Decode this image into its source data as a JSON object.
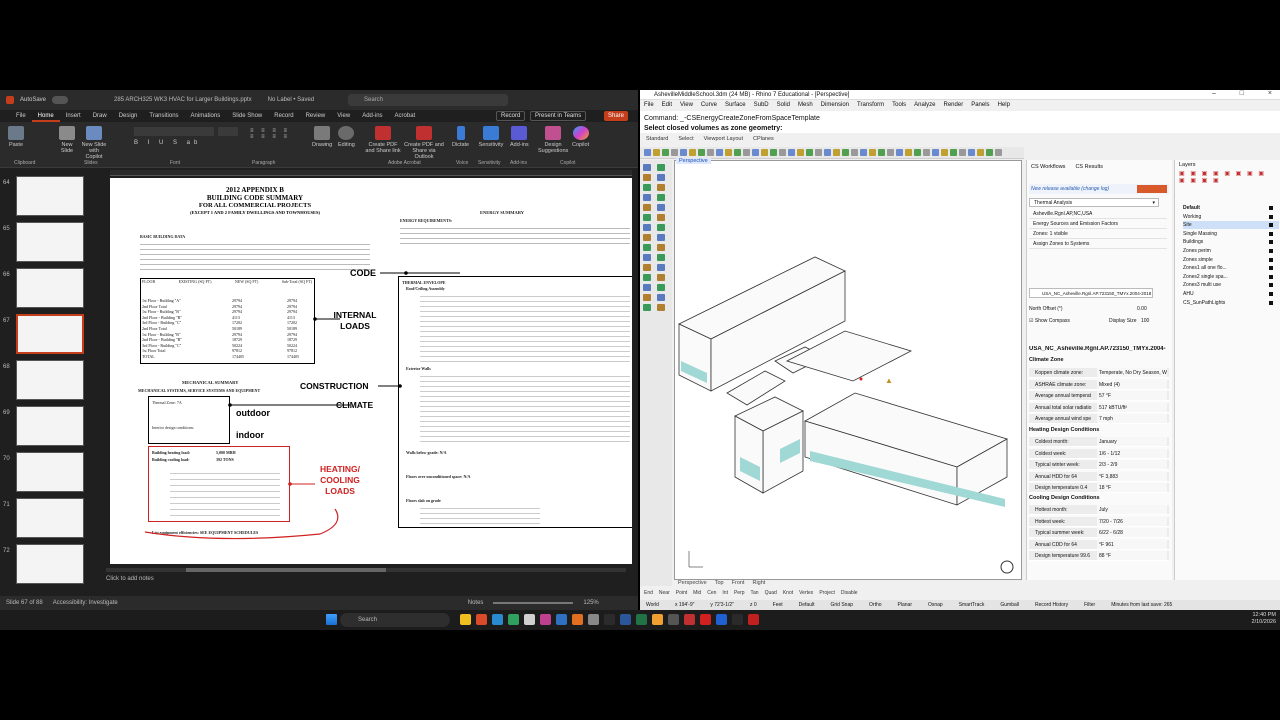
{
  "ppt": {
    "autosave": "AutoSave",
    "file_title": "285 ARCH325 WK3 HVAC for Larger Buildings.pptx",
    "label": "No Label • Saved",
    "search_placeholder": "Search",
    "menu": [
      "File",
      "Home",
      "Insert",
      "Draw",
      "Design",
      "Transitions",
      "Animations",
      "Slide Show",
      "Record",
      "Review",
      "View",
      "Add-ins",
      "Acrobat"
    ],
    "record_btn": "Record",
    "present_btn": "Present in Teams",
    "share_btn": "Share",
    "ribbon": {
      "paste": "Paste",
      "new_slide": "New Slide",
      "new_slide_copilot": "New Slide with Copilot",
      "drawing": "Drawing",
      "editing": "Editing",
      "create_pdf_link": "Create PDF and Share link",
      "create_pdf_outlook": "Create PDF and Share via Outlook",
      "dictate": "Dictate",
      "sensitivity": "Sensitivity",
      "addins": "Add-ins",
      "design_suggestions": "Design Suggestions",
      "copilot": "Copilot",
      "groups": [
        "Clipboard",
        "Slides",
        "Font",
        "Paragraph",
        "Adobe Acrobat",
        "Voice",
        "Sensitivity",
        "Add-ins",
        "Copilot"
      ]
    },
    "thumb_numbers": [
      "64",
      "65",
      "66",
      "67",
      "68",
      "69",
      "70",
      "71",
      "72"
    ],
    "notes": "Click to add notes",
    "status_slide": "Slide 67 of 88",
    "status_access": "Accessibility: Investigate",
    "status_notes": "Notes",
    "zoom": "125%"
  },
  "slide": {
    "title1": "2012 APPENDIX B",
    "title2": "BUILDING CODE SUMMARY",
    "title3": "FOR ALL COMMERCIAL PROJECTS",
    "title4": "(EXCEPT 1 AND 2 FAMILY DWELLINGS AND TOWNHOUSES)",
    "basic": "BASIC BUILDING DATA",
    "mech_summary": "MECHANICAL SUMMARY",
    "mech_sub": "MECHANICAL SYSTEMS, SERVICE SYSTEMS AND EQUIPMENT",
    "energy_summary": "ENERGY SUMMARY",
    "energy_req": "ENERGY REQUIREMENTS:",
    "thermal_env": "THERMAL ENVELOPE",
    "roof": "Roof/Ceiling Assembly",
    "ext_walls": "Exterior Walls",
    "walls_below": "Walls below grade: N/A",
    "floors_over": "Floors over unconditioned space: N/A",
    "floors_slab": "Floors slab on grade",
    "heating_load": "Building heating load:",
    "heating_val": "5,000 MBH",
    "cooling_load": "Building cooling load:",
    "cooling_val": "392 TONS",
    "thermal_zone": "Thermal Zone: 7A",
    "interior_cond": "Interior design conditions:",
    "list_equip": "List equipment efficiencies: SEE EQUIPMENT SCHEDULES",
    "callouts": {
      "code": "CODE",
      "internal": "INTERNAL LOADS",
      "construction": "CONSTRUCTION",
      "climate": "CLIMATE",
      "outdoor": "outdoor",
      "indoor": "indoor",
      "heating": "HEATING/ COOLING LOADS"
    },
    "table_rows": [
      [
        "1st Floor - Building \"A\"",
        "29794",
        "29794"
      ],
      [
        "2nd Floor Total",
        "29794",
        "29794"
      ],
      [
        "1st Floor - Building \"B\"",
        "29794",
        "29794"
      ],
      [
        "2nd Floor - Building \"B\"",
        "4113",
        "4113"
      ],
      [
        "3rd Floor - Building \"C\"",
        "17202",
        "17202"
      ],
      [
        "2nd Floor Total",
        "50189",
        "50189"
      ],
      [
        "1st Floor - Building \"B\"",
        "29794",
        "29794"
      ],
      [
        "2nd Floor - Building \"B\"",
        "18729",
        "18729"
      ],
      [
        "3rd Floor - Building \"C\"",
        "50224",
        "50224"
      ],
      [
        "1st Floor Total",
        "97812",
        "97812"
      ],
      [
        "TOTAL",
        "174405",
        "174405"
      ]
    ],
    "table_headers": [
      "FLOOR",
      "EXISTING (SQ FT)",
      "NEW (SQ FT)",
      "Sub-Total (SQ FT)"
    ]
  },
  "rhino": {
    "title": "AshevilleMiddleSchool.3dm (24 MB) - Rhino 7 Educational - [Perspective]",
    "menu": [
      "File",
      "Edit",
      "View",
      "Curve",
      "Surface",
      "SubD",
      "Solid",
      "Mesh",
      "Dimension",
      "Transform",
      "Tools",
      "Analyze",
      "Render",
      "Panels",
      "Help"
    ],
    "command": "Command: _-CSEnergyCreateZoneFromSpaceTemplate",
    "prompt": "Select closed volumes as zone geometry:",
    "toolbar_tabs": [
      "Standard",
      "Select",
      "Viewport Layout",
      "CPlanes"
    ],
    "viewport_label": "Perspective",
    "vp_tabs": [
      "Perspective",
      "Top",
      "Front",
      "Right"
    ],
    "osnaps": [
      "End",
      "Near",
      "Point",
      "Mid",
      "Cen",
      "Int",
      "Perp",
      "Tan",
      "Quad",
      "Knot",
      "Vertex",
      "Project",
      "Disable"
    ],
    "status": [
      "World",
      "x 194'-9\"",
      "y 72'3-1/2\"",
      "z 0",
      "Feet",
      "Default",
      "Grid Snap",
      "Ortho",
      "Planar",
      "Osnap",
      "SmartTrack",
      "Gumball",
      "Record History",
      "Filter",
      "Minutes from last save: 265"
    ],
    "cs_tabs": [
      "CS Workflows",
      "CS Results"
    ],
    "new_release": "New release available (change log)",
    "dropdown": "Thermal Analysis",
    "workflow_items": [
      "Asheville.Rgnl.AP,NC,USA",
      "Energy Sources and Emission Factors",
      "Zones: 1 visible",
      "Assign Zones to Systems"
    ],
    "weather_file": "USA_NC_Asheville.Rgnl.AP.723150_TMYx.2004-2018",
    "north_offset_label": "North Offset (°)",
    "north_offset_val": "0.00",
    "show_compass": "Show Compass",
    "display_size_label": "Display Size",
    "display_size_val": "100",
    "location_title": "USA_NC_Asheville.Rgnl.AP.723150_TMYx.2004-",
    "climate_zone": "Climate Zone",
    "climate_props": [
      [
        "Koppen climate zone:",
        "Temperate, No Dry Season, W"
      ],
      [
        "ASHRAE climate zone:",
        "Mixed (4)"
      ],
      [
        "Average annual temperat",
        "57 °F"
      ],
      [
        "Annual total solar radiatio",
        "517 kBTU/ft²"
      ],
      [
        "Average annual wind spe",
        "7 mph"
      ]
    ],
    "heating_title": "Heating Design Conditions",
    "heating_props": [
      [
        "Coldest month:",
        "January"
      ],
      [
        "Coldest week:",
        "1/6 - 1/12"
      ],
      [
        "Typical winter week:",
        "2/3 - 2/9"
      ],
      [
        "Annual HDD for 64",
        "°F 3,883"
      ],
      [
        "Design temperature 0.4",
        "18 °F"
      ]
    ],
    "cooling_title": "Cooling Design Conditions",
    "cooling_props": [
      [
        "Hottest month:",
        "July"
      ],
      [
        "Hottest week:",
        "7/20 - 7/26"
      ],
      [
        "Typical summer week:",
        "6/22 - 6/28"
      ],
      [
        "Annual CDD for 64",
        "°F 961"
      ],
      [
        "Design temperature 99.6",
        "88 °F"
      ]
    ],
    "layers_title": "Layers",
    "layers": [
      "Default",
      "Working",
      "Site",
      "Single Massing",
      "Buildings",
      "Zones perim",
      "Zones simple",
      "Zones1 all one flo...",
      "Zones2 single spa...",
      "Zones3 multi use",
      "AHU",
      "CS_SunPathLights"
    ]
  },
  "taskbar": {
    "search": "Search",
    "time": "12:40 PM",
    "date": "2/10/2026"
  }
}
